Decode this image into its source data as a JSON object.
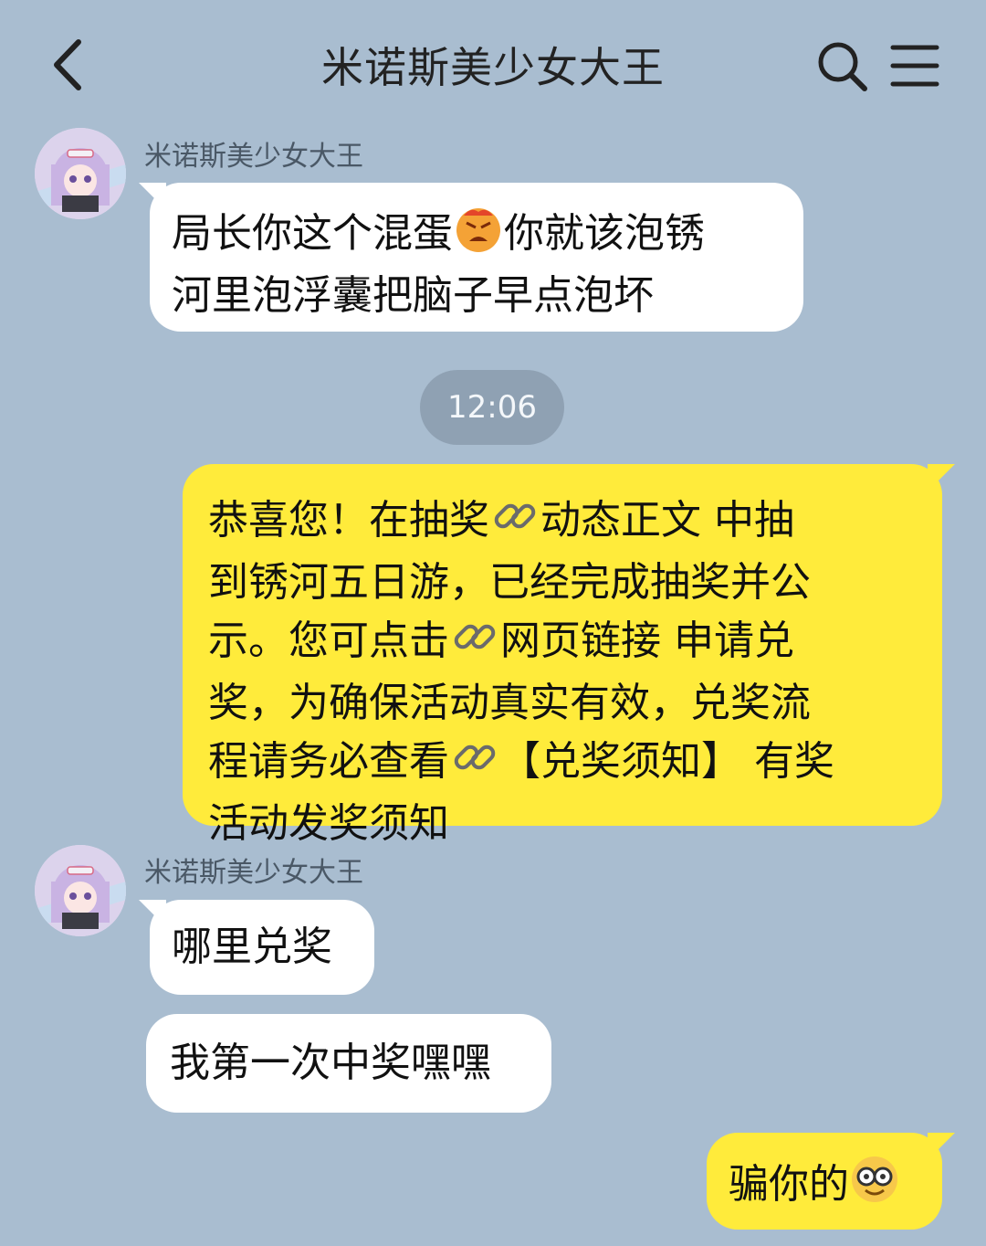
{
  "header": {
    "title": "米诺斯美少女大王",
    "back_icon": "chevron-left-icon",
    "search_icon": "search-icon",
    "menu_icon": "menu-icon"
  },
  "messages": [
    {
      "direction": "incoming",
      "sender": "米诺斯美少女大王",
      "line1a": "局长你这个混蛋",
      "emoji1": "angry-face-emoji",
      "line1b": "你就该泡锈",
      "line2": "河里泡浮囊把脑子早点泡坏"
    },
    {
      "type": "timestamp",
      "text": "12:06"
    },
    {
      "direction": "outgoing",
      "l1a": "恭喜您！在抽奖",
      "l1b": "动态正文 中抽",
      "l2": "到锈河五日游，已经完成抽奖并公",
      "l3a": "示。您可点击",
      "l3b": "网页链接 申请兑",
      "l4": "奖，为确保活动真实有效，兑奖流",
      "l5a": "程请务必查看",
      "l5b": "【兑奖须知】 有奖",
      "l6": "活动发奖须知",
      "link_icon": "link-icon"
    },
    {
      "direction": "incoming",
      "sender": "米诺斯美少女大王",
      "text": "哪里兑奖"
    },
    {
      "direction": "incoming",
      "text": "我第一次中奖嘿嘿"
    },
    {
      "direction": "outgoing",
      "text": "骗你的",
      "emoji": "nerd-face-emoji"
    }
  ],
  "colors": {
    "background": "#a9bdd0",
    "outgoing_bubble": "#ffeb3b",
    "incoming_bubble": "#ffffff",
    "timestamp_pill": "#8fa1b3"
  }
}
